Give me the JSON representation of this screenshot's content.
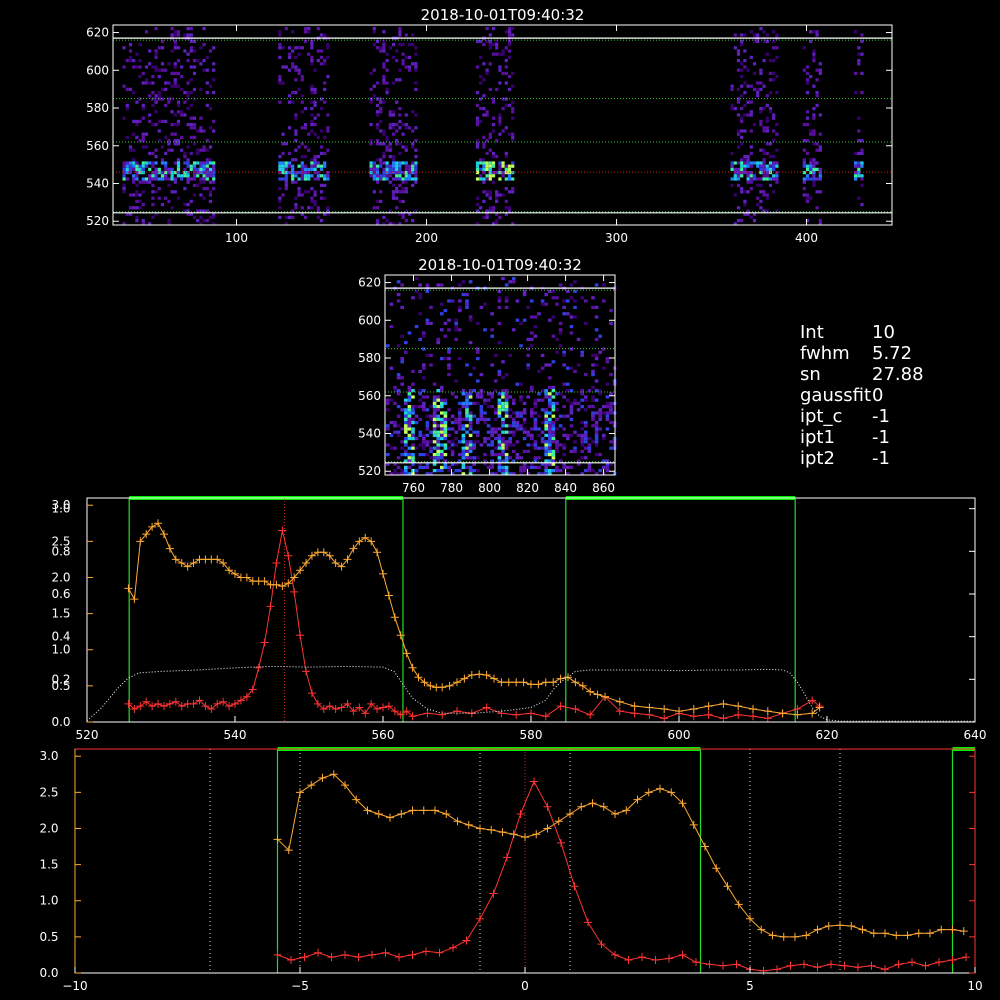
{
  "colors": {
    "background": "#000000",
    "axis": "#ffffff",
    "guide_line": "#33cc33",
    "green_box": "#22dd22",
    "green_bar": "#00ee00",
    "red_series": "#ff3333",
    "orange_series": "#ffaa33",
    "white_dotted": "#ffffff"
  },
  "info_box": [
    {
      "key": "Int",
      "value": "10"
    },
    {
      "key": "fwhm",
      "value": "5.72"
    },
    {
      "key": "sn",
      "value": "27.88"
    },
    {
      "key": "gaussfit",
      "value": "0"
    },
    {
      "key": "ipt_c",
      "value": "-1"
    },
    {
      "key": "ipt1",
      "value": "-1"
    },
    {
      "key": "ipt2",
      "value": "-1"
    }
  ],
  "chart_data": [
    {
      "type": "heatmap",
      "title": "2018-10-01T09:40:32",
      "xlim": [
        35,
        445
      ],
      "ylim": [
        518,
        624
      ],
      "x_ticks": [
        "100",
        "200",
        "300",
        "400"
      ],
      "x_tick_values": [
        100,
        200,
        300,
        400
      ],
      "y_ticks": [
        "520",
        "540",
        "560",
        "580",
        "600",
        "620"
      ],
      "y_tick_values": [
        520,
        540,
        560,
        580,
        600,
        620
      ],
      "guide_lines_y": [
        616,
        585,
        562,
        525
      ],
      "center_line_y": 546,
      "signal_columns_x": [
        [
          40,
          88
        ],
        [
          122,
          148
        ],
        [
          170,
          195
        ],
        [
          226,
          245
        ],
        [
          360,
          385
        ],
        [
          398,
          408
        ],
        [
          425,
          430
        ]
      ],
      "bright_band_y": [
        542,
        552
      ]
    },
    {
      "type": "heatmap",
      "title": "2018-10-01T09:40:32",
      "xlim": [
        745,
        866
      ],
      "ylim": [
        518,
        624
      ],
      "x_ticks": [
        "760",
        "780",
        "800",
        "820",
        "840",
        "860"
      ],
      "x_tick_values": [
        760,
        780,
        800,
        820,
        840,
        860
      ],
      "y_ticks": [
        "520",
        "540",
        "560",
        "580",
        "600",
        "620"
      ],
      "y_tick_values": [
        520,
        540,
        560,
        580,
        600,
        620
      ],
      "guide_lines_y": [
        616,
        585,
        562,
        525
      ],
      "streaks_x": [
        757,
        773,
        787,
        806,
        830
      ]
    },
    {
      "type": "line",
      "xlim": [
        520,
        640
      ],
      "x_ticks": [
        "520",
        "540",
        "560",
        "580",
        "600",
        "620",
        "640"
      ],
      "x_tick_values": [
        520,
        540,
        560,
        580,
        600,
        620,
        640
      ],
      "y_left_primary_ticks": [
        "0.0",
        "0.5",
        "1.0",
        "1.5",
        "2.0",
        "2.5",
        "3.0"
      ],
      "y_left_primary_values": [
        0,
        0.5,
        1.0,
        1.5,
        2.0,
        2.5,
        3.0
      ],
      "y_left_secondary_ticks": [
        "0.2",
        "0.4",
        "0.6",
        "0.8",
        "1.0"
      ],
      "y_left_secondary_values": [
        0.2,
        0.4,
        0.6,
        0.8,
        1.0
      ],
      "ylim": [
        0,
        3.1
      ],
      "green_boxes_x": [
        [
          525.7,
          562.7
        ],
        [
          584.7,
          615.7
        ]
      ],
      "vline_red_x": 546.7,
      "series": [
        {
          "color": "red",
          "x": [
            525.6,
            526.4,
            527.2,
            528.0,
            528.8,
            529.6,
            530.4,
            531.2,
            532.0,
            532.8,
            533.6,
            534.4,
            535.2,
            536.0,
            536.8,
            537.6,
            538.4,
            539.2,
            540.0,
            540.8,
            541.6,
            542.4,
            543.2,
            544.0,
            544.8,
            545.6,
            546.4,
            547.2,
            548.0,
            548.8,
            549.6,
            550.4,
            551.2,
            552.0,
            552.8,
            553.6,
            554.4,
            555.2,
            556.0,
            556.8,
            557.6,
            558.4,
            559.2,
            560.0,
            560.8,
            561.6,
            562.4,
            563.2,
            564.0,
            566.0,
            568.0,
            570.0,
            572.0,
            574.0,
            576.0,
            578.0,
            580.0,
            582.0,
            584.0,
            586.0,
            588.0,
            590.0,
            592.0,
            594.0,
            596.0,
            598.0,
            600.0,
            602.0,
            604.0,
            606.0,
            608.0,
            610.0,
            612.0,
            614.0,
            616.0,
            618.0,
            619.0
          ],
          "y": [
            0.25,
            0.18,
            0.22,
            0.28,
            0.22,
            0.25,
            0.22,
            0.25,
            0.28,
            0.22,
            0.25,
            0.25,
            0.3,
            0.22,
            0.18,
            0.25,
            0.28,
            0.22,
            0.25,
            0.3,
            0.35,
            0.45,
            0.75,
            1.1,
            1.6,
            2.2,
            2.65,
            2.3,
            1.8,
            1.2,
            0.7,
            0.4,
            0.25,
            0.18,
            0.22,
            0.18,
            0.2,
            0.25,
            0.15,
            0.2,
            0.12,
            0.25,
            0.18,
            0.2,
            0.22,
            0.15,
            0.1,
            0.15,
            0.08,
            0.12,
            0.1,
            0.15,
            0.12,
            0.2,
            0.12,
            0.1,
            0.12,
            0.08,
            0.22,
            0.18,
            0.1,
            0.35,
            0.15,
            0.12,
            0.1,
            0.05,
            0.12,
            0.08,
            0.1,
            0.05,
            0.1,
            0.08,
            0.05,
            0.12,
            0.18,
            0.3,
            0.22
          ]
        },
        {
          "color": "orange",
          "x": [
            525.6,
            526.4,
            527.2,
            528.0,
            528.8,
            529.6,
            530.4,
            531.2,
            532.0,
            532.8,
            533.6,
            534.4,
            535.2,
            536.0,
            536.8,
            537.6,
            538.4,
            539.2,
            540.0,
            540.8,
            541.6,
            542.4,
            543.2,
            544.0,
            544.8,
            545.6,
            546.4,
            547.2,
            548.0,
            548.8,
            549.6,
            550.4,
            551.2,
            552.0,
            552.8,
            553.6,
            554.4,
            555.2,
            556.0,
            556.8,
            557.6,
            558.4,
            559.2,
            560.0,
            560.8,
            561.6,
            562.4,
            563.2,
            564.0,
            564.8,
            565.6,
            566.4,
            567.2,
            568.0,
            569.0,
            570.0,
            571.0,
            572.0,
            573.0,
            574.0,
            575.0,
            576.0,
            577.0,
            578.0,
            579.0,
            580.0,
            581.0,
            582.0,
            583.0,
            584.0,
            585.0,
            586.0,
            587.0,
            588.0,
            589.0,
            590.0,
            592.0,
            594.0,
            596.0,
            598.0,
            600.0,
            602.0,
            604.0,
            606.0,
            608.0,
            610.0,
            612.0,
            614.0,
            616.0,
            618.0,
            619.0
          ],
          "y": [
            1.85,
            1.7,
            2.5,
            2.6,
            2.7,
            2.75,
            2.6,
            2.4,
            2.25,
            2.2,
            2.15,
            2.2,
            2.25,
            2.25,
            2.25,
            2.25,
            2.2,
            2.1,
            2.05,
            2.0,
            2.0,
            1.95,
            1.95,
            1.95,
            1.9,
            1.9,
            1.88,
            1.92,
            2.0,
            2.1,
            2.2,
            2.3,
            2.35,
            2.35,
            2.3,
            2.2,
            2.15,
            2.25,
            2.4,
            2.5,
            2.55,
            2.5,
            2.35,
            2.05,
            1.75,
            1.45,
            1.2,
            0.95,
            0.75,
            0.62,
            0.55,
            0.5,
            0.48,
            0.48,
            0.5,
            0.55,
            0.6,
            0.65,
            0.66,
            0.65,
            0.6,
            0.55,
            0.55,
            0.55,
            0.55,
            0.52,
            0.52,
            0.55,
            0.55,
            0.6,
            0.62,
            0.55,
            0.5,
            0.42,
            0.38,
            0.35,
            0.28,
            0.22,
            0.2,
            0.18,
            0.15,
            0.18,
            0.22,
            0.25,
            0.22,
            0.18,
            0.15,
            0.12,
            0.1,
            0.12,
            0.2
          ]
        },
        {
          "color": "white-dotted",
          "x": [
            520,
            522,
            524,
            525.5,
            527,
            530,
            535,
            540,
            545,
            550,
            555,
            560,
            561.5,
            562.5,
            564,
            566,
            568,
            572,
            576,
            580,
            582,
            583,
            584,
            585,
            586,
            588,
            592,
            596,
            600,
            604,
            608,
            612,
            614,
            615,
            616,
            617,
            618,
            619,
            620,
            622,
            626,
            630,
            635,
            640
          ],
          "y": [
            0.02,
            0.2,
            0.45,
            0.6,
            0.68,
            0.7,
            0.72,
            0.75,
            0.77,
            0.76,
            0.77,
            0.76,
            0.7,
            0.55,
            0.33,
            0.18,
            0.12,
            0.12,
            0.15,
            0.2,
            0.3,
            0.45,
            0.55,
            0.62,
            0.7,
            0.72,
            0.72,
            0.72,
            0.71,
            0.72,
            0.72,
            0.73,
            0.72,
            0.68,
            0.55,
            0.38,
            0.2,
            0.08,
            0.03,
            0.01,
            0.01,
            0.01,
            0.01,
            0.01
          ]
        }
      ]
    },
    {
      "type": "line",
      "xlim": [
        -10,
        10
      ],
      "x_ticks": [
        "−10",
        "−5",
        "0",
        "5",
        "10"
      ],
      "x_tick_values": [
        -10,
        -5,
        0,
        5,
        10
      ],
      "y_ticks": [
        "0.0",
        "0.5",
        "1.0",
        "1.5",
        "2.0",
        "2.5",
        "3.0"
      ],
      "y_tick_values": [
        0,
        0.5,
        1.0,
        1.5,
        2.0,
        2.5,
        3.0
      ],
      "ylim": [
        0,
        3.1
      ],
      "green_boxes_x": [
        [
          -5.5,
          3.9
        ],
        [
          9.5,
          10
        ]
      ],
      "dotted_vlines_x": [
        -7,
        -5,
        -1,
        1,
        5,
        7
      ],
      "vline_red_x": 0,
      "series": [
        {
          "color": "red",
          "x": [
            -5.5,
            -5.2,
            -4.9,
            -4.6,
            -4.3,
            -4.0,
            -3.7,
            -3.4,
            -3.1,
            -2.8,
            -2.5,
            -2.2,
            -1.9,
            -1.6,
            -1.3,
            -1.0,
            -0.7,
            -0.4,
            -0.1,
            0.2,
            0.5,
            0.8,
            1.1,
            1.4,
            1.7,
            2.0,
            2.3,
            2.6,
            2.9,
            3.2,
            3.5,
            3.8,
            4.1,
            4.4,
            4.7,
            5.0,
            5.3,
            5.6,
            5.9,
            6.2,
            6.5,
            6.8,
            7.1,
            7.4,
            7.7,
            8.0,
            8.3,
            8.6,
            8.9,
            9.2,
            9.5,
            9.8
          ],
          "y": [
            0.25,
            0.18,
            0.22,
            0.28,
            0.22,
            0.25,
            0.22,
            0.25,
            0.28,
            0.22,
            0.25,
            0.3,
            0.28,
            0.35,
            0.45,
            0.75,
            1.1,
            1.6,
            2.2,
            2.65,
            2.3,
            1.8,
            1.2,
            0.7,
            0.4,
            0.25,
            0.18,
            0.22,
            0.18,
            0.2,
            0.25,
            0.15,
            0.12,
            0.1,
            0.12,
            0.05,
            0.03,
            0.05,
            0.1,
            0.12,
            0.08,
            0.12,
            0.1,
            0.08,
            0.1,
            0.05,
            0.12,
            0.15,
            0.1,
            0.15,
            0.18,
            0.22
          ]
        },
        {
          "color": "orange",
          "x": [
            -5.5,
            -5.25,
            -5.0,
            -4.75,
            -4.5,
            -4.25,
            -4.0,
            -3.75,
            -3.5,
            -3.25,
            -3.0,
            -2.75,
            -2.5,
            -2.25,
            -2.0,
            -1.75,
            -1.5,
            -1.25,
            -1.0,
            -0.75,
            -0.5,
            -0.25,
            0.0,
            0.25,
            0.5,
            0.75,
            1.0,
            1.25,
            1.5,
            1.75,
            2.0,
            2.25,
            2.5,
            2.75,
            3.0,
            3.25,
            3.5,
            3.75,
            4.0,
            4.25,
            4.5,
            4.75,
            5.0,
            5.25,
            5.5,
            5.75,
            6.0,
            6.25,
            6.5,
            6.75,
            7.0,
            7.25,
            7.5,
            7.75,
            8.0,
            8.25,
            8.5,
            8.75,
            9.0,
            9.25,
            9.5,
            9.75
          ],
          "y": [
            1.85,
            1.7,
            2.5,
            2.6,
            2.7,
            2.75,
            2.6,
            2.4,
            2.25,
            2.2,
            2.15,
            2.2,
            2.25,
            2.25,
            2.25,
            2.2,
            2.1,
            2.05,
            2.0,
            1.98,
            1.95,
            1.92,
            1.88,
            1.92,
            2.0,
            2.1,
            2.2,
            2.3,
            2.35,
            2.3,
            2.2,
            2.25,
            2.4,
            2.5,
            2.55,
            2.5,
            2.35,
            2.05,
            1.75,
            1.45,
            1.2,
            0.95,
            0.75,
            0.6,
            0.52,
            0.5,
            0.5,
            0.52,
            0.6,
            0.65,
            0.66,
            0.65,
            0.6,
            0.55,
            0.55,
            0.52,
            0.52,
            0.55,
            0.55,
            0.6,
            0.6,
            0.58
          ]
        }
      ]
    }
  ]
}
